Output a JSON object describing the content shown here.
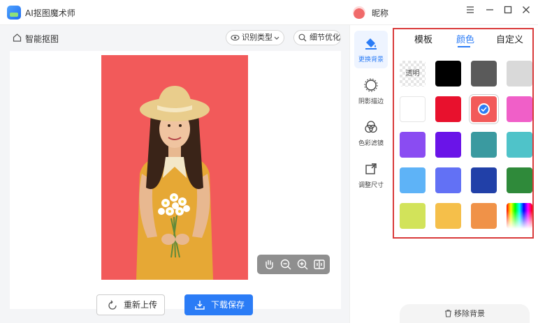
{
  "app": {
    "title": "AI抠图魔术师",
    "nickname": "昵称"
  },
  "window": {
    "menu_icon": "menu-icon",
    "min_icon": "minimize-icon",
    "max_icon": "maximize-icon",
    "close_icon": "close-icon"
  },
  "main": {
    "label": "智能抠图",
    "recognize_type": "识别类型",
    "detail_optimize": "细节优化",
    "photo_bg": "#f25a5a",
    "reupload": "重新上传",
    "download_save": "下载保存"
  },
  "sidebar": {
    "items": [
      {
        "label": "更换背景",
        "icon": "paint-bucket-icon",
        "active": true
      },
      {
        "label": "阴影描边",
        "icon": "shadow-circle-icon"
      },
      {
        "label": "色彩滤镜",
        "icon": "color-filter-icon"
      },
      {
        "label": "调整尺寸",
        "icon": "resize-icon"
      }
    ]
  },
  "panel": {
    "tabs": [
      "模板",
      "颜色",
      "自定义"
    ],
    "active_tab": "颜色",
    "transparent_label": "透明",
    "colors": [
      "#000000",
      "#5a5a5a",
      "#d9d9d9",
      "#ffffff",
      "#e8112d",
      "#f25a5a",
      "#f05fc8",
      "#8a4cf2",
      "#6a14e8",
      "#3a9aa0",
      "#4fc3c9",
      "#5eb3f7",
      "#6271f5",
      "#2140a8",
      "#2f8a3a",
      "#d2e35a",
      "#f5bf4a",
      "#f09248"
    ],
    "selected_color": "#f25a5a",
    "remove_bg": "移除背景"
  },
  "accent": "#2b7cf6",
  "highlight_border": "#d93a3a"
}
